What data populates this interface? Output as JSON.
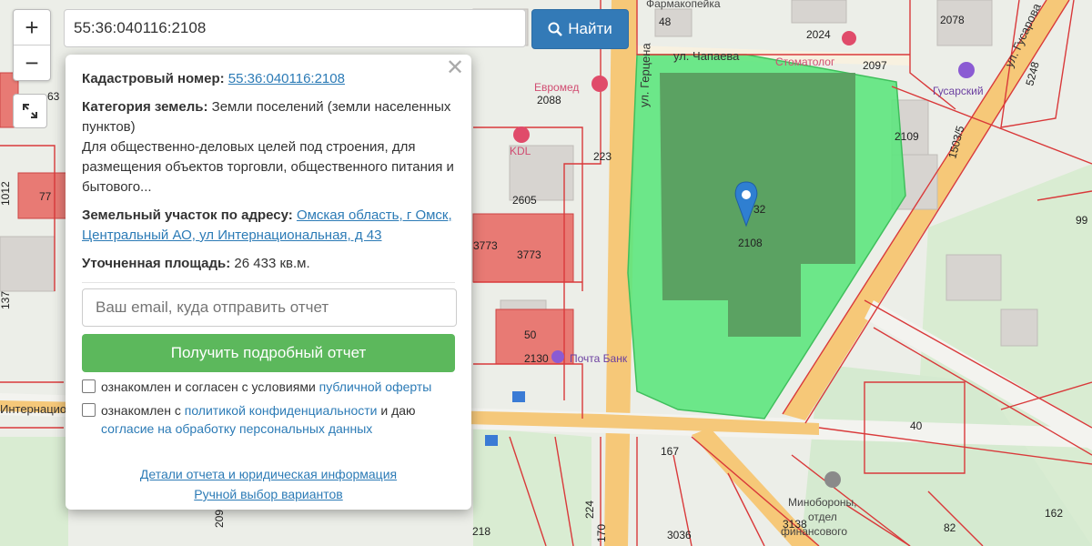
{
  "search": {
    "value": "55:36:040116:2108",
    "button_label": "Найти"
  },
  "controls": {
    "zoom_in": "+",
    "zoom_out": "−"
  },
  "popup": {
    "close_symbol": "✕",
    "cadastral_label": "Кадастровый номер:",
    "cadastral_value": "55:36:040116:2108",
    "category_label": "Категория земель:",
    "category_value": "Земли поселений (земли населенных пунктов)",
    "usage": "Для общественно-деловых целей под строения, для размещения объектов торговли, общественного питания и бытового...",
    "address_label": "Земельный участок по адресу:",
    "address_value": "Омская область, г Омск, Центральный АО, ул Интернациональная, д 43",
    "area_label": "Уточненная площадь:",
    "area_value": "26 433 кв.м.",
    "email_placeholder": "Ваш email, куда отправить отчет",
    "report_button": "Получить подробный отчет",
    "offer_text": "ознакомлен и согласен с условиями",
    "offer_link": "публичной оферты",
    "privacy_text1": "ознакомлен с",
    "privacy_link": "политикой конфиденциальности",
    "privacy_text2": "и даю",
    "consent_link": "согласие на обработку персональных данных",
    "details_link": "Детали отчета и юридическая информация",
    "manual_link": "Ручной выбор вариантов"
  },
  "map": {
    "parcel_label": "2108",
    "parcel_small": "32",
    "streets": [
      "ул. Герцена",
      "ул. Чапаева",
      "ул. Гусарова",
      "Интернациона"
    ],
    "pois": [
      "Евромед",
      "Стоматолог",
      "Гусарский",
      "Почта Банк",
      "Минобороны, отдел финансового",
      "Фармакопейка",
      "KDL"
    ],
    "numbers": [
      "48",
      "2024",
      "2078",
      "2097",
      "5248",
      "2088",
      "223",
      "2109",
      "1503/5",
      "2605",
      "3773",
      "50",
      "2130",
      "99",
      "77",
      "137",
      "40",
      "167",
      "224",
      "170",
      "218",
      "3036",
      "3138",
      "82",
      "162",
      "209",
      "63",
      "1012"
    ],
    "colors": {
      "parcel_fill": "#5ee67e",
      "parcel_building": "#5a9a5e",
      "boundary": "#d9393a",
      "road": "#f5c87a",
      "marker": "#2f7fd1"
    }
  }
}
